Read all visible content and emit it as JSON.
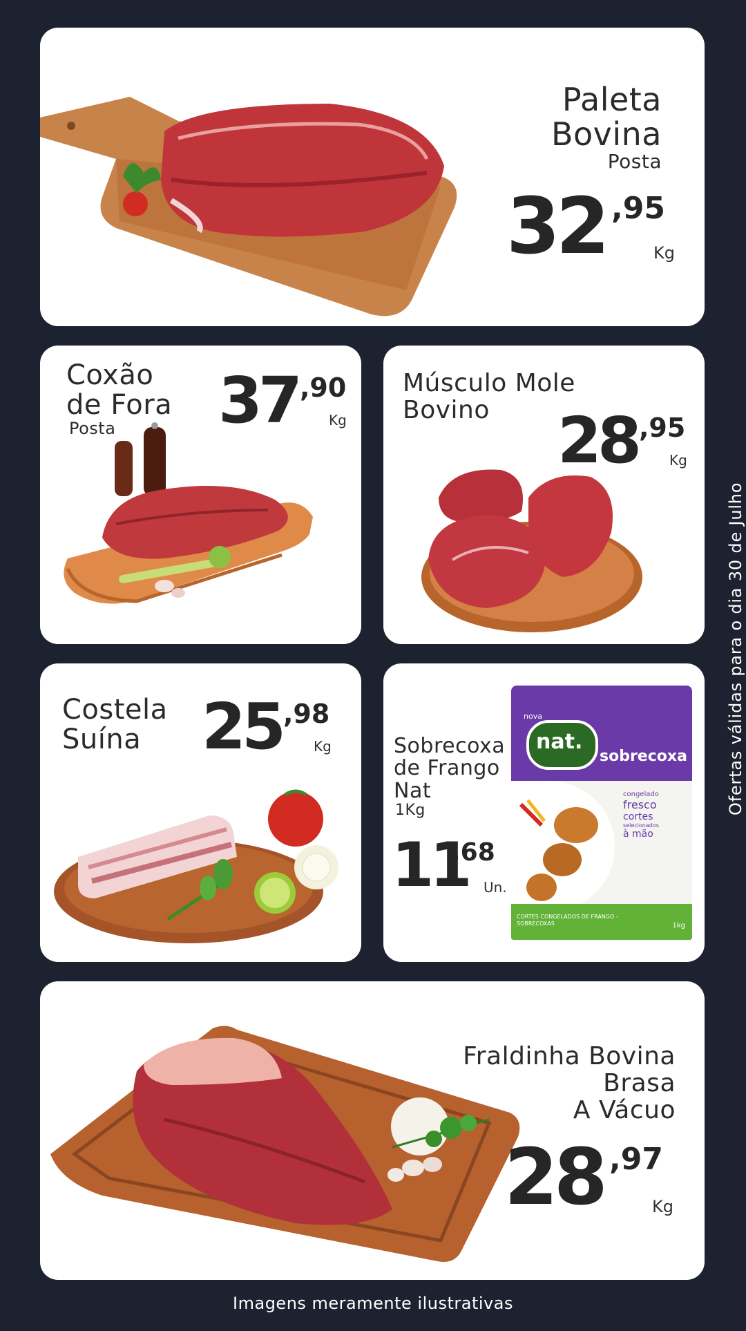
{
  "products": [
    {
      "name_lines": [
        "Paleta",
        "Bovina"
      ],
      "detail": "Posta",
      "price_int": "32",
      "price_cents": ",95",
      "unit": "Kg"
    },
    {
      "name_lines": [
        "Coxão",
        "de Fora"
      ],
      "detail": "Posta",
      "price_int": "37",
      "price_cents": ",90",
      "unit": "Kg"
    },
    {
      "name_lines": [
        "Músculo Mole",
        "Bovino"
      ],
      "detail": "",
      "price_int": "28",
      "price_cents": ",95",
      "unit": "Kg"
    },
    {
      "name_lines": [
        "Costela",
        "Suína"
      ],
      "detail": "",
      "price_int": "25",
      "price_cents": ",98",
      "unit": "Kg"
    },
    {
      "name_lines": [
        "Sobrecoxa",
        "de Frango",
        "Nat"
      ],
      "detail": "1Kg",
      "price_int": "11",
      "price_cents": ",68",
      "unit": "Un."
    },
    {
      "name_lines": [
        "Fraldinha Bovina",
        "Brasa",
        "A Vácuo"
      ],
      "detail": "",
      "price_int": "28",
      "price_cents": ",97",
      "unit": "Kg"
    }
  ],
  "package": {
    "brand_small": "nova",
    "brand": "nat.",
    "product": "sobrecoxa",
    "claim_1": "congelado",
    "claim_2": "fresco",
    "claim_3": "cortes",
    "claim_4": "selecionados",
    "claim_5": "à mão",
    "footer": "CORTES CONGELADOS DE FRANGO - SOBRECOXAS",
    "weight": "1kg"
  },
  "side_note": "Ofertas válidas para o dia 30 de Julho",
  "footer_note": "Imagens meramente ilustrativas",
  "colors": {
    "background": "#1d2230",
    "card": "#ffffff",
    "price": "#262626",
    "package": "#6a3aa8",
    "package_green": "#62b237"
  },
  "icons": [
    "cutting-board-icon",
    "meat-icon",
    "tomato-icon",
    "pepper-grinder-icon",
    "celery-icon",
    "garlic-icon",
    "lime-icon",
    "onion-icon",
    "mint-icon",
    "parsley-icon",
    "ribs-icon"
  ]
}
